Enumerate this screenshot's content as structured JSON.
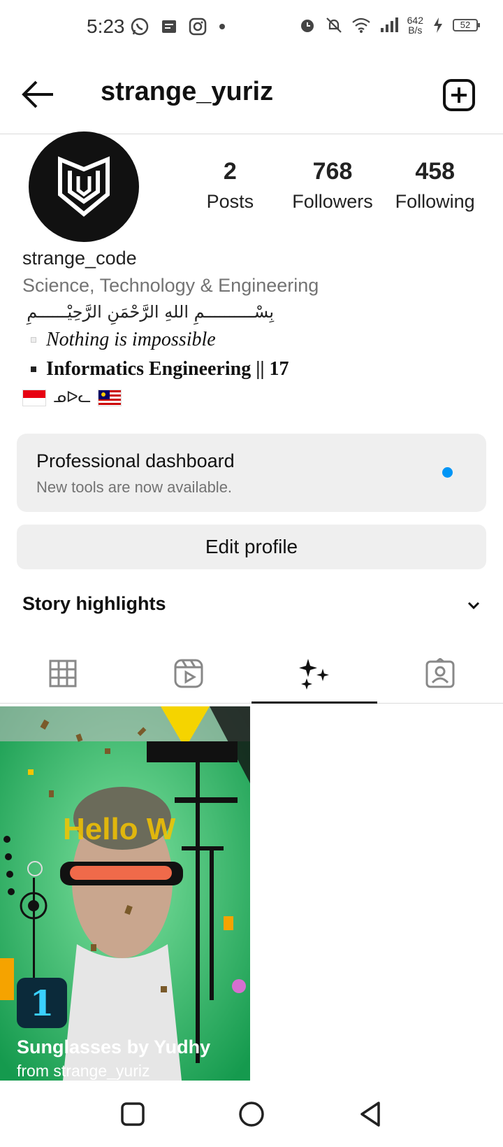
{
  "status_bar": {
    "time": "5:23",
    "net_speed_value": "642",
    "net_speed_unit": "B/s",
    "battery": "52",
    "left_icons": [
      "whatsapp-icon",
      "message-icon",
      "instagram-icon",
      "dot-icon"
    ],
    "right_icons": [
      "alarm-icon",
      "mute-icon",
      "wifi-icon",
      "signal-icon",
      "charging-icon"
    ]
  },
  "header": {
    "username": "strange_yuriz"
  },
  "profile": {
    "stats": [
      {
        "value": "2",
        "label": "Posts"
      },
      {
        "value": "768",
        "label": "Followers"
      },
      {
        "value": "458",
        "label": "Following"
      }
    ],
    "name": "strange_code",
    "category": "Science, Technology & Engineering",
    "bio_arabic": "بِسْــــــــــمِ اللهِ الرَّحْمَنِ الرَّحِيْــــــمِ",
    "bio_line1": "Nothing is impossible",
    "bio_line2": "Informatics Engineering || 17",
    "bio_flags_symbol": "ᓄᐅᓚ"
  },
  "dashboard": {
    "title": "Professional dashboard",
    "subtitle": "New tools are now available."
  },
  "edit_profile_label": "Edit profile",
  "story_highlights_label": "Story highlights",
  "tabs": [
    "grid-icon",
    "reels-icon",
    "effects-icon",
    "tagged-icon"
  ],
  "effect_post": {
    "badge": "1",
    "name": "Sunglasses by Yudhy",
    "from": "from strange_yuriz",
    "overlay_text": "Hello W",
    "colors": {
      "background": "#2fb36a",
      "accent": "#f5c400",
      "visor": "#f06a4a"
    }
  }
}
